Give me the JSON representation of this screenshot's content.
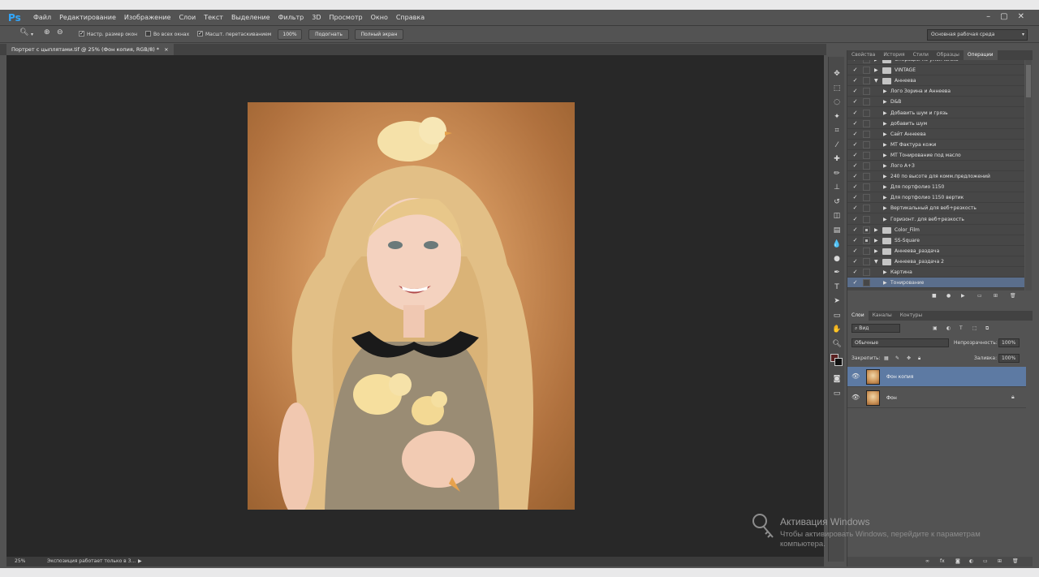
{
  "app": {
    "logo": "Ps",
    "menu": [
      "Файл",
      "Редактирование",
      "Изображение",
      "Слои",
      "Текст",
      "Выделение",
      "Фильтр",
      "3D",
      "Просмотр",
      "Окно",
      "Справка"
    ],
    "window_controls": [
      "–",
      "▢",
      "✕"
    ]
  },
  "options_bar": {
    "resize_windows": "Настр. размер окон",
    "all_windows": "Во всех окнах",
    "scrubby_zoom": "Масшт. перетаскиванием",
    "zoom_100": "100%",
    "fit": "Подогнать",
    "full_screen": "Полный экран",
    "workspace": "Основная рабочая среда"
  },
  "document": {
    "tab_title": "Портрет с цыплятами.tif @ 25% (Фон копия, RGB/8) *",
    "close": "×"
  },
  "status": {
    "zoom": "25%",
    "info": "Экспозиция работает только в 3..."
  },
  "panel_tabs": [
    "Свойства",
    "История",
    "Стили",
    "Образцы",
    "Операции"
  ],
  "actions": [
    {
      "label": "Операции по умолчанию",
      "type": "folder",
      "level": 0,
      "open": false,
      "box": false
    },
    {
      "label": "VINTAGE",
      "type": "folder",
      "level": 0,
      "open": false,
      "box": false
    },
    {
      "label": "Аннеева",
      "type": "folder",
      "level": 0,
      "open": true,
      "box": false
    },
    {
      "label": "Лого Зорина и Аннеева",
      "type": "action",
      "level": 1,
      "box": false
    },
    {
      "label": "D&B",
      "type": "action",
      "level": 1,
      "box": false
    },
    {
      "label": "Добавить шум и грязь",
      "type": "action",
      "level": 1,
      "box": false
    },
    {
      "label": "добавить шум",
      "type": "action",
      "level": 1,
      "box": false
    },
    {
      "label": "Сайт Аннеева",
      "type": "action",
      "level": 1,
      "box": false
    },
    {
      "label": "МТ Фактура кожи",
      "type": "action",
      "level": 1,
      "box": false
    },
    {
      "label": "МТ Тонирование под масло",
      "type": "action",
      "level": 1,
      "box": false
    },
    {
      "label": "Лого А+З",
      "type": "action",
      "level": 1,
      "box": false
    },
    {
      "label": "240 по высоте для комм.предложений",
      "type": "action",
      "level": 1,
      "box": false
    },
    {
      "label": "Для портфолио 1150",
      "type": "action",
      "level": 1,
      "box": false
    },
    {
      "label": "Для портфолио 1150 вертик",
      "type": "action",
      "level": 1,
      "box": false
    },
    {
      "label": "Вертикальный для веб+резкость",
      "type": "action",
      "level": 1,
      "box": false
    },
    {
      "label": "Горизонт. для веб+резкость",
      "type": "action",
      "level": 1,
      "box": false
    },
    {
      "label": "Color_Film",
      "type": "folder",
      "level": 0,
      "open": false,
      "box": true
    },
    {
      "label": "SS-Square",
      "type": "folder",
      "level": 0,
      "open": false,
      "box": true
    },
    {
      "label": "Аннеева_раздача",
      "type": "folder",
      "level": 0,
      "open": false,
      "box": false
    },
    {
      "label": "Аннеева_раздача 2",
      "type": "folder",
      "level": 0,
      "open": true,
      "box": false
    },
    {
      "label": "Картина",
      "type": "action",
      "level": 1,
      "box": false
    },
    {
      "label": "Тонирование",
      "type": "action",
      "level": 1,
      "box": false,
      "selected": true
    }
  ],
  "layers_tabs": [
    "Слои",
    "Каналы",
    "Контуры"
  ],
  "layers": {
    "filter_kind": "Вид",
    "blend_mode": "Обычные",
    "opacity_label": "Непрозрачность:",
    "opacity_value": "100%",
    "lock_label": "Закрепить:",
    "fill_label": "Заливка:",
    "fill_value": "100%",
    "items": [
      {
        "name": "Фон копия",
        "selected": true,
        "locked": false
      },
      {
        "name": "Фон",
        "selected": false,
        "locked": true
      }
    ]
  },
  "watermark": {
    "title": "Активация Windows",
    "text": "Чтобы активировать Windows, перейдите к параметрам компьютера."
  }
}
